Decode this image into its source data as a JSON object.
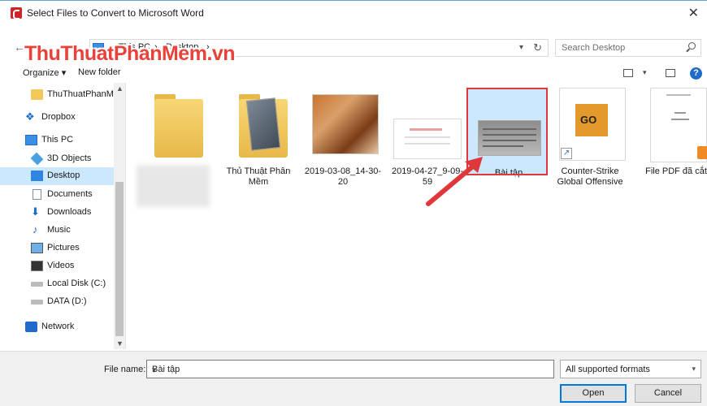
{
  "window": {
    "title": "Select Files to Convert to Microsoft Word",
    "close": "✕"
  },
  "nav": {
    "back": "←",
    "up": "↑",
    "breadcrumb": [
      "This PC",
      "Desktop"
    ],
    "separator": "›",
    "search_placeholder": "Search Desktop"
  },
  "watermark": {
    "part1": "ThuThuat",
    "part2": "PhanMem",
    "part3": ".vn"
  },
  "cmdbar": {
    "organize": "Organize ▾",
    "new_folder": "New folder",
    "help": "?"
  },
  "sidebar": {
    "items": [
      {
        "label": "ThuThuatPhanM",
        "icon": "folder-icon"
      },
      {
        "label": "Dropbox",
        "icon": "dropbox-icon"
      },
      {
        "label": "This PC",
        "icon": "pc-icon"
      },
      {
        "label": "3D Objects",
        "icon": "cube-icon"
      },
      {
        "label": "Desktop",
        "icon": "desktop-icon"
      },
      {
        "label": "Documents",
        "icon": "document-icon"
      },
      {
        "label": "Downloads",
        "icon": "download-icon"
      },
      {
        "label": "Music",
        "icon": "music-icon"
      },
      {
        "label": "Pictures",
        "icon": "pictures-icon"
      },
      {
        "label": "Videos",
        "icon": "video-icon"
      },
      {
        "label": "Local Disk (C:)",
        "icon": "disk-icon"
      },
      {
        "label": "DATA (D:)",
        "icon": "disk-icon"
      },
      {
        "label": "Network",
        "icon": "network-icon"
      }
    ]
  },
  "files": [
    {
      "name": "",
      "kind": "folder"
    },
    {
      "name": "Thủ Thuật Phân Mềm",
      "kind": "folder"
    },
    {
      "name": "2019-03-08_14-30-20",
      "kind": "image"
    },
    {
      "name": "2019-04-27_9-09-59",
      "kind": "image"
    },
    {
      "name": "Bài tập",
      "kind": "image",
      "selected": true
    },
    {
      "name": "Counter-Strike Global Offensive",
      "kind": "shortcut"
    },
    {
      "name": "File PDF đã cắt",
      "kind": "pdf"
    }
  ],
  "csgo": {
    "logo_text": "GO"
  },
  "bottom": {
    "file_name_label": "File name:",
    "file_name_value": "Bài tập",
    "filter": "All supported formats",
    "open": "Open",
    "cancel": "Cancel"
  },
  "colors": {
    "accent": "#0078d7",
    "selection": "#cce8ff",
    "highlight_red": "#e0383a"
  }
}
